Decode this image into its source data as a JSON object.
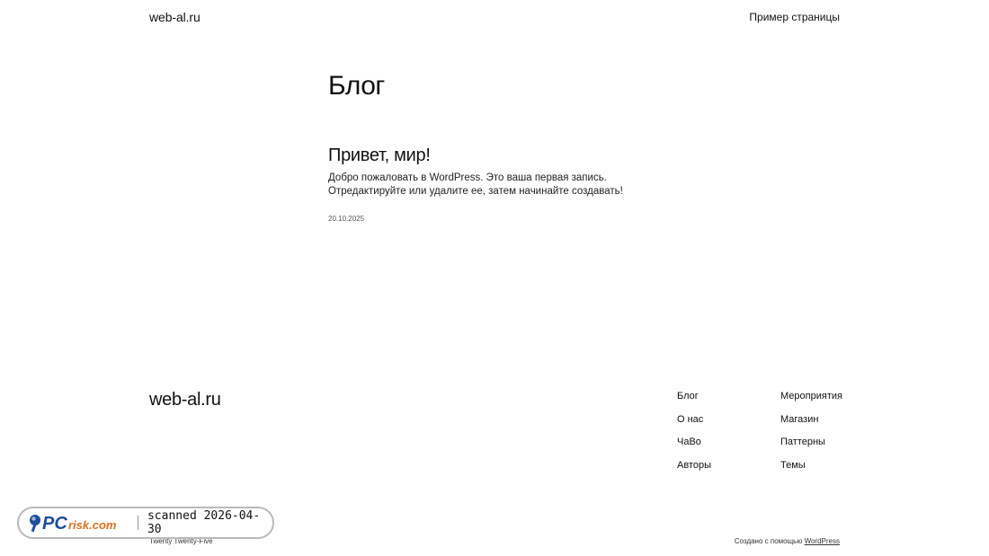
{
  "header": {
    "site_title": "web-al.ru",
    "nav_link": "Пример страницы"
  },
  "main": {
    "page_title": "Блог",
    "post": {
      "title": "Привет, мир!",
      "excerpt": "Добро пожаловать в WordPress. Это ваша первая запись. Отредактируйте или удалите ее, затем начинайте создавать!",
      "date": "20.10.2025"
    }
  },
  "footer": {
    "site_title": "web-al.ru",
    "col1": [
      "Блог",
      "О нас",
      "ЧаВо",
      "Авторы"
    ],
    "col2": [
      "Мероприятия",
      "Магазин",
      "Паттерны",
      "Темы"
    ],
    "theme_name": "Twenty Twenty-Five",
    "credit_prefix": "Создано с помощью ",
    "credit_link": "WordPress"
  },
  "watermark": {
    "logo_text": "PCrisk.com",
    "scan_text": "scanned 2026-04-30"
  },
  "colors": {
    "text": "#111111",
    "background": "#ffffff",
    "watermark_logo": "#1f4e9b"
  }
}
